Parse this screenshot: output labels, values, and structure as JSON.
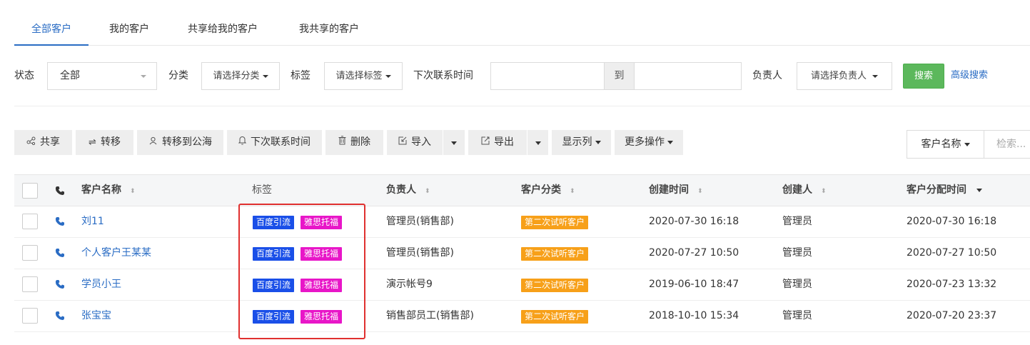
{
  "tabs": [
    {
      "label": "全部客户",
      "active": true
    },
    {
      "label": "我的客户",
      "active": false
    },
    {
      "label": "共享给我的客户",
      "active": false
    },
    {
      "label": "我共享的客户",
      "active": false
    }
  ],
  "filters": {
    "status_label": "状态",
    "status_value": "全部",
    "category_label": "分类",
    "category_placeholder": "请选择分类",
    "tag_label": "标签",
    "tag_placeholder": "请选择标签",
    "next_contact_label": "下次联系时间",
    "date_separator": "到",
    "owner_label": "负责人",
    "owner_placeholder": "请选择负责人",
    "search_button": "搜索",
    "advanced_search": "高级搜索"
  },
  "toolbar": {
    "share": "共享",
    "transfer": "转移",
    "transfer_public": "转移到公海",
    "next_contact": "下次联系时间",
    "delete": "删除",
    "import": "导入",
    "export": "导出",
    "columns": "显示列",
    "more": "更多操作",
    "keyword_field": "客户名称",
    "keyword_placeholder": "检索..."
  },
  "table": {
    "headers": {
      "name": "客户名称",
      "tags": "标签",
      "owner": "负责人",
      "category": "客户分类",
      "created_at": "创建时间",
      "creator": "创建人",
      "assigned_at": "客户分配时间"
    },
    "rows": [
      {
        "name": "刘11",
        "tags": [
          "百度引流",
          "雅思托福"
        ],
        "owner": "管理员(销售部)",
        "category": "第二次试听客户",
        "created_at": "2020-07-30 16:18",
        "creator": "管理员",
        "assigned_at": "2020-07-30 16:18"
      },
      {
        "name": "个人客户王某某",
        "tags": [
          "百度引流",
          "雅思托福"
        ],
        "owner": "管理员(销售部)",
        "category": "第二次试听客户",
        "created_at": "2020-07-27 10:50",
        "creator": "管理员",
        "assigned_at": "2020-07-27 10:50"
      },
      {
        "name": "学员小王",
        "tags": [
          "百度引流",
          "雅思托福"
        ],
        "owner": "演示帐号9",
        "category": "第二次试听客户",
        "created_at": "2019-06-10 18:47",
        "creator": "管理员",
        "assigned_at": "2020-07-23 13:32"
      },
      {
        "name": "张宝宝",
        "tags": [
          "百度引流",
          "雅思托福"
        ],
        "owner": "销售部员工(销售部)",
        "category": "第二次试听客户",
        "created_at": "2018-10-10 15:34",
        "creator": "管理员",
        "assigned_at": "2020-07-20 23:37"
      }
    ]
  },
  "colors": {
    "accent": "#2a6cc4",
    "search_green": "#5cb85c",
    "tag_blue": "#1a4fe8",
    "tag_pink": "#e816c8",
    "category_orange": "#f7a019",
    "highlight_red": "#e0302f"
  }
}
